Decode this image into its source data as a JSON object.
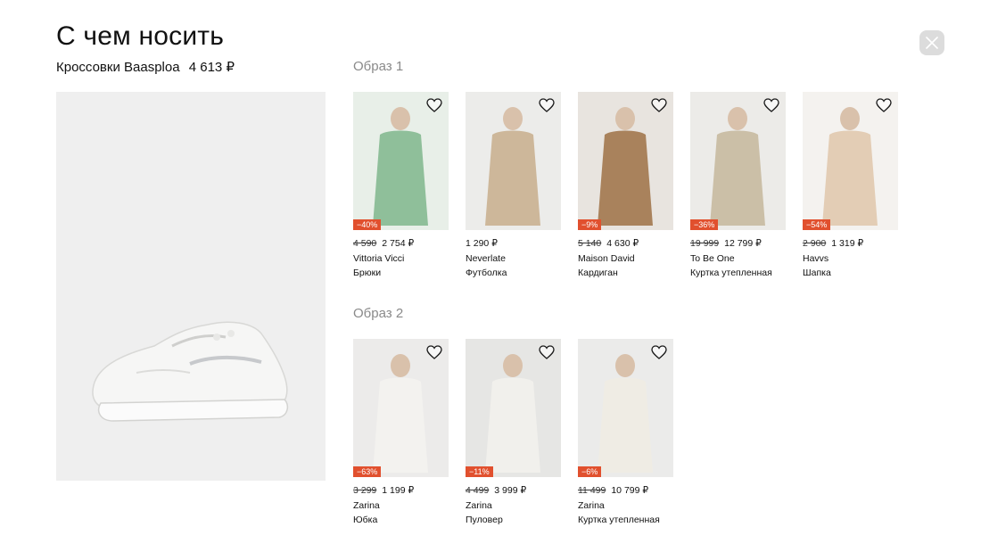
{
  "header": {
    "title": "С чем носить",
    "product_name": "Кроссовки Baasploa",
    "product_price": "4 613 ₽"
  },
  "looks": [
    {
      "title": "Образ 1",
      "items": [
        {
          "discount": "−40%",
          "old_price": "4 590",
          "price": "2 754 ₽",
          "brand": "Vittoria Vicci",
          "type": "Брюки",
          "bg": "#e8efe8",
          "garment": "#8fbf9a"
        },
        {
          "discount": "",
          "old_price": "",
          "price": "1 290 ₽",
          "brand": "Neverlate",
          "type": "Футболка",
          "bg": "#ececea",
          "garment": "#cdb79a"
        },
        {
          "discount": "−9%",
          "old_price": "5 140",
          "price": "4 630 ₽",
          "brand": "Maison David",
          "type": "Кардиган",
          "bg": "#e8e4df",
          "garment": "#a9825c"
        },
        {
          "discount": "−36%",
          "old_price": "19 999",
          "price": "12 799 ₽",
          "brand": "To Be One",
          "type": "Куртка утепленная",
          "bg": "#ecebe8",
          "garment": "#cbbfa7"
        },
        {
          "discount": "−54%",
          "old_price": "2 900",
          "price": "1 319 ₽",
          "brand": "Havvs",
          "type": "Шапка",
          "bg": "#f4f2ef",
          "garment": "#e3cdb5"
        }
      ]
    },
    {
      "title": "Образ 2",
      "items": [
        {
          "discount": "−63%",
          "old_price": "3 299",
          "price": "1 199 ₽",
          "brand": "Zarina",
          "type": "Юбка",
          "bg": "#ecebea",
          "garment": "#f3f2ef"
        },
        {
          "discount": "−11%",
          "old_price": "4 499",
          "price": "3 999 ₽",
          "brand": "Zarina",
          "type": "Пуловер",
          "bg": "#e6e6e4",
          "garment": "#f1f0ec"
        },
        {
          "discount": "−6%",
          "old_price": "11 499",
          "price": "10 799 ₽",
          "brand": "Zarina",
          "type": "Куртка утепленная",
          "bg": "#ebebea",
          "garment": "#efece4"
        }
      ]
    }
  ],
  "colors": {
    "badge": "#e1502e",
    "muted": "#8a8a8a",
    "close_button_bg": "#dcdcdc"
  },
  "icons": {
    "close": "close-icon",
    "favorite": "heart-icon"
  }
}
